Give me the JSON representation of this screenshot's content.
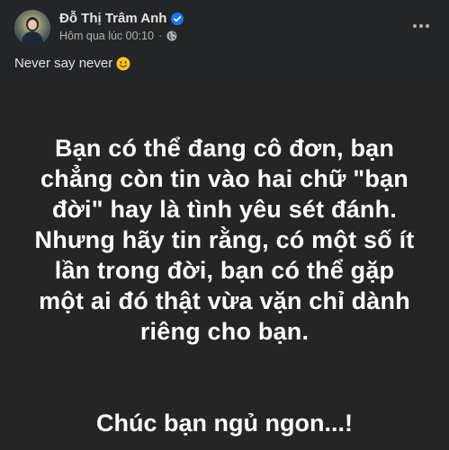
{
  "post": {
    "author": "Đỗ Thị Trâm Anh",
    "timestamp": "Hôm qua lúc 00:10",
    "separator": "·",
    "caption": "Never say never",
    "icons": {
      "verified": "verified-badge-icon",
      "audience": "globe-icon",
      "emoji": "smiling-face-icon",
      "more": "more-options-icon"
    }
  },
  "image": {
    "quote_lines": [
      "Bạn có thể đang cô đơn, bạn",
      "chẳng còn tin vào hai chữ \"bạn",
      "đời\" hay là tình yêu sét đánh.",
      "Nhưng hãy tin rằng, có một số ít",
      "lần trong đời, bạn có thể gặp",
      "một ai đó thật vừa vặn chỉ dành",
      "riêng cho bạn."
    ],
    "closing": "Chúc bạn ngủ ngon...!"
  },
  "colors": {
    "background": "#242526",
    "image_background": "#252525",
    "verified": "#1877f2",
    "secondary_text": "#b0b3b8"
  }
}
